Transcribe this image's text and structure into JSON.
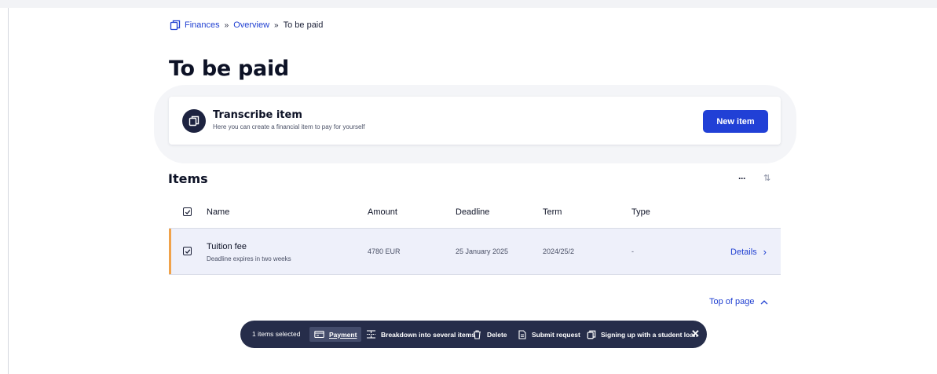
{
  "breadcrumb": {
    "items": [
      "Finances",
      "Overview"
    ],
    "separator": "»",
    "current": "To be paid",
    "icon": "document-copy-icon"
  },
  "page": {
    "title": "To be paid"
  },
  "transcribe_card": {
    "title": "Transcribe item",
    "subtitle": "Here you can create a financial item to pay for yourself",
    "button": "New item",
    "icon": "document-copy-icon"
  },
  "items_section": {
    "title": "Items",
    "more_icon": "more-icon",
    "sort_icon": "sort-icon",
    "columns": [
      "Name",
      "Amount",
      "Deadline",
      "Term",
      "Type"
    ],
    "rows": [
      {
        "name": "Tuition fee",
        "note": "Deadline expires in two weeks",
        "amount": "4780 EUR",
        "deadline": "25 January 2025",
        "term": "2024/25/2",
        "type": "-",
        "action": "Details",
        "checked": true
      }
    ]
  },
  "top_link": "Top of page",
  "action_bar": {
    "count": "1 items selected",
    "actions": [
      {
        "label": "Payment",
        "icon": "payment-icon",
        "active": true
      },
      {
        "label": "Breakdown into several items",
        "icon": "split-icon",
        "active": false
      },
      {
        "label": "Delete",
        "icon": "trash-icon",
        "active": false
      },
      {
        "label": "Submit request",
        "icon": "document-icon",
        "active": false
      },
      {
        "label": "Signing up with a student loan",
        "icon": "document-copy-icon",
        "active": false
      }
    ],
    "close_icon": "close-icon"
  },
  "colors": {
    "accent_blue": "#2140d6",
    "link_blue": "#1f3fd1",
    "dark_navy": "#262d4a",
    "row_accent": "#f0a24a",
    "row_bg": "#eef0fa"
  }
}
